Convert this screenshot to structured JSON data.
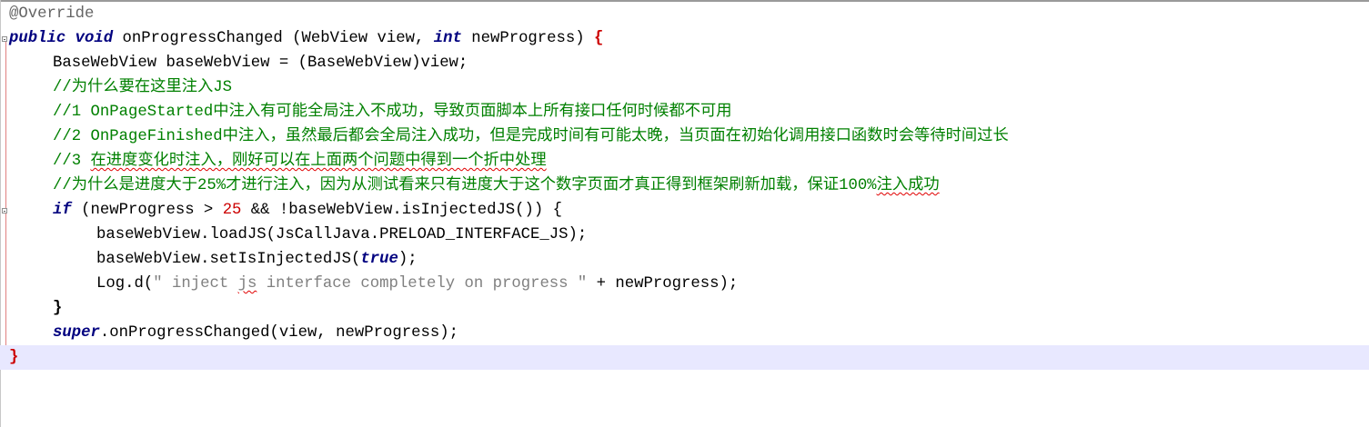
{
  "editor": {
    "lines": [
      {
        "annotation": "@Override"
      },
      {
        "kw_public": "public",
        "kw_void": "void",
        "method_name": "onProgressChanged",
        "params_open": " (WebView view, ",
        "kw_int": "int",
        "params_close": " newProgress) ",
        "brace_open": "{"
      },
      {
        "text": "BaseWebView baseWebView = (BaseWebView)view;"
      },
      {
        "comment": "//为什么要在这里注入JS"
      },
      {
        "comment": "//1 OnPageStarted中注入有可能全局注入不成功，导致页面脚本上所有接口任何时候都不可用"
      },
      {
        "comment": "//2 OnPageFinished中注入，虽然最后都会全局注入成功，但是完成时间有可能太晚，当页面在初始化调用接口函数时会等待时间过长"
      },
      {
        "comment_prefix": "//3 ",
        "comment_squiggle": "在进度变化时注入，刚好可以在上面两个问题中得到一个折中处理"
      },
      {
        "comment_prefix": "//为什么是进度大于25%才进行注入，因为从测试看来只有进度大于这个数字页面才真正得到框架刷新加载，保证100%",
        "comment_squiggle": "注入成功"
      },
      {
        "kw_if": "if",
        "cond_a": " (newProgress > ",
        "number": "25",
        "cond_b": " && !baseWebView.isInjectedJS()) {"
      },
      {
        "text": "baseWebView.loadJS(JsCallJava.PRELOAD_INTERFACE_JS);"
      },
      {
        "text_a": "baseWebView.setIsInjectedJS(",
        "kw_true": "true",
        "text_b": ");"
      },
      {
        "text_a": "Log.d(",
        "string_a": "\" inject ",
        "string_squiggle": "js",
        "string_b": " interface completely on progress \"",
        "text_b": " + newProgress);"
      },
      {
        "text": "}"
      },
      {
        "kw_super": "super",
        "text": ".onProgressChanged(view, newProgress);"
      },
      {
        "brace_close": "}"
      }
    ]
  }
}
